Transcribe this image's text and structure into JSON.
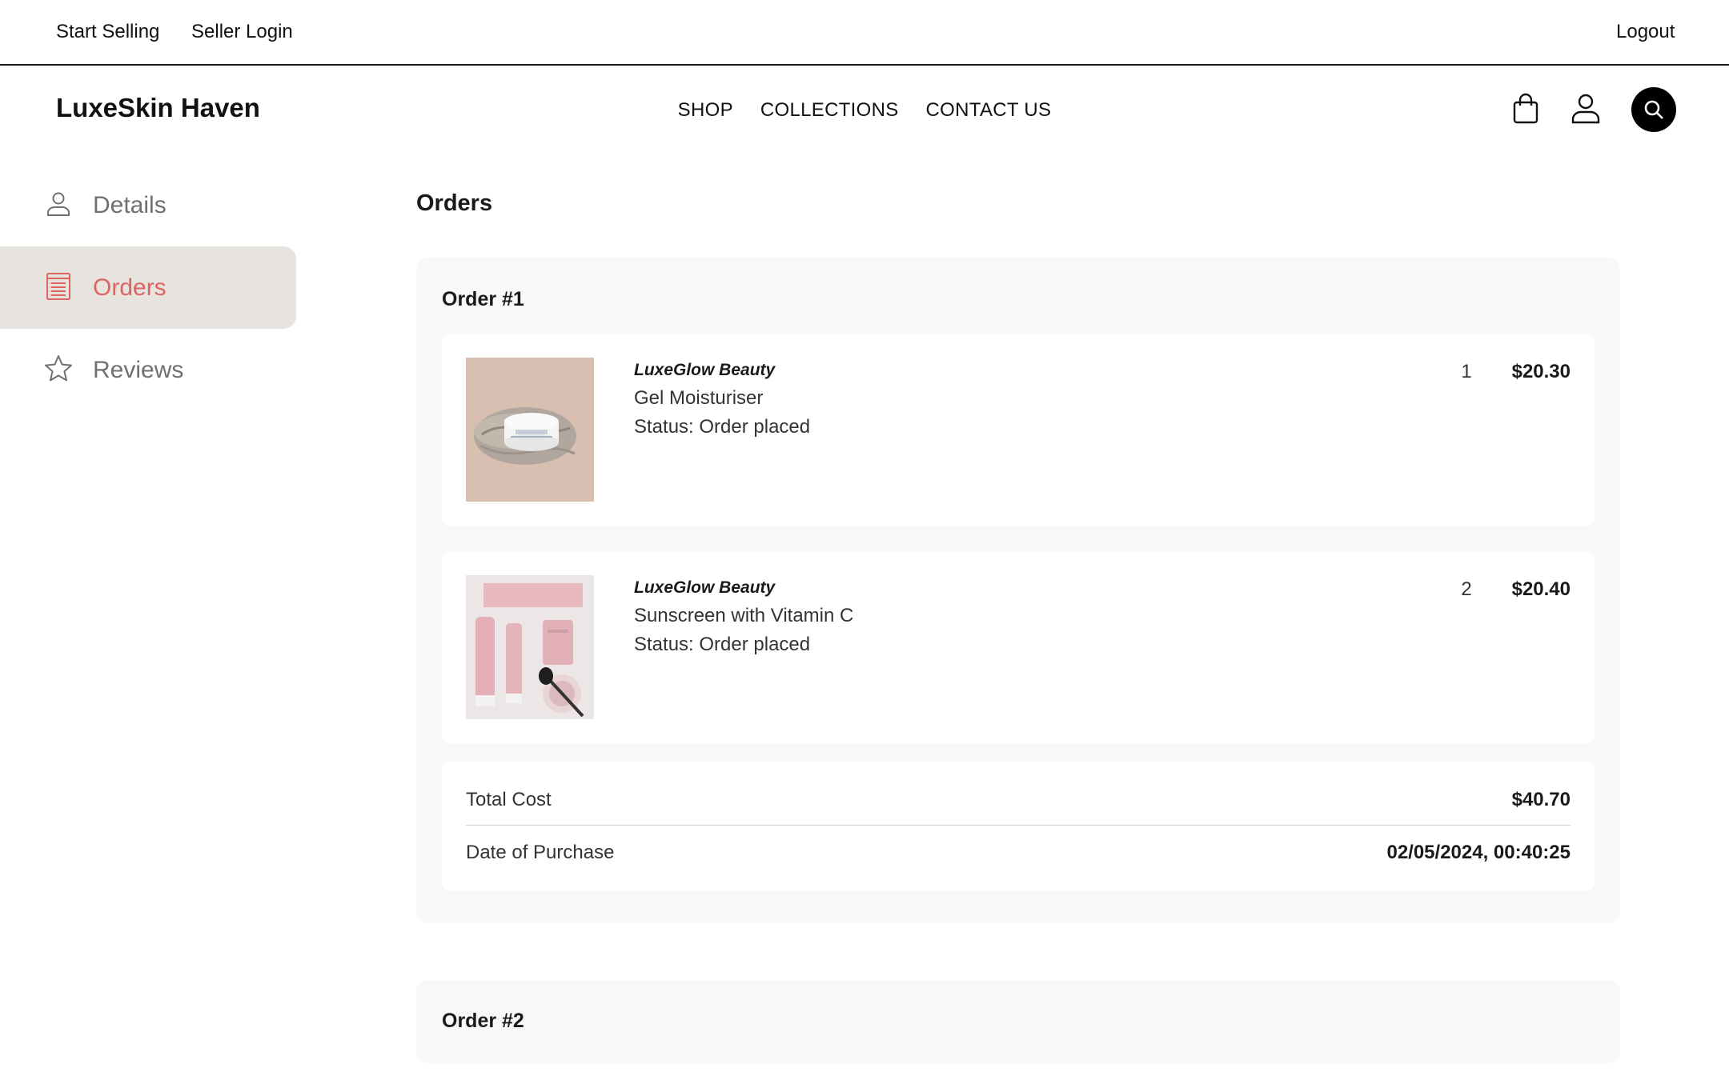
{
  "topbar": {
    "start_selling": "Start Selling",
    "seller_login": "Seller Login",
    "logout": "Logout"
  },
  "header": {
    "brand": "LuxeSkin Haven",
    "nav": [
      "SHOP",
      "COLLECTIONS",
      "CONTACT US"
    ],
    "icons": [
      "shopping-bag-icon",
      "user-icon",
      "search-icon"
    ]
  },
  "sidebar": {
    "items": [
      {
        "label": "Details",
        "icon": "user-icon",
        "active": false
      },
      {
        "label": "Orders",
        "icon": "receipt-icon",
        "active": true
      },
      {
        "label": "Reviews",
        "icon": "star-icon",
        "active": false
      }
    ]
  },
  "colors": {
    "accent": "#de6461",
    "active_bg": "#e7e3de",
    "card_bg": "#f8f8f8"
  },
  "main": {
    "title": "Orders",
    "orders": [
      {
        "title": "Order #1",
        "items": [
          {
            "brand": "LuxeGlow Beauty",
            "name": "Gel Moisturiser",
            "status": "Status: Order placed",
            "qty": "1",
            "price": "$20.30"
          },
          {
            "brand": "LuxeGlow Beauty",
            "name": "Sunscreen with Vitamin C",
            "status": "Status: Order placed",
            "qty": "2",
            "price": "$20.40"
          }
        ],
        "summary": {
          "total_label": "Total Cost",
          "total_value": "$40.70",
          "date_label": "Date of Purchase",
          "date_value": "02/05/2024, 00:40:25"
        }
      },
      {
        "title": "Order #2"
      }
    ]
  }
}
